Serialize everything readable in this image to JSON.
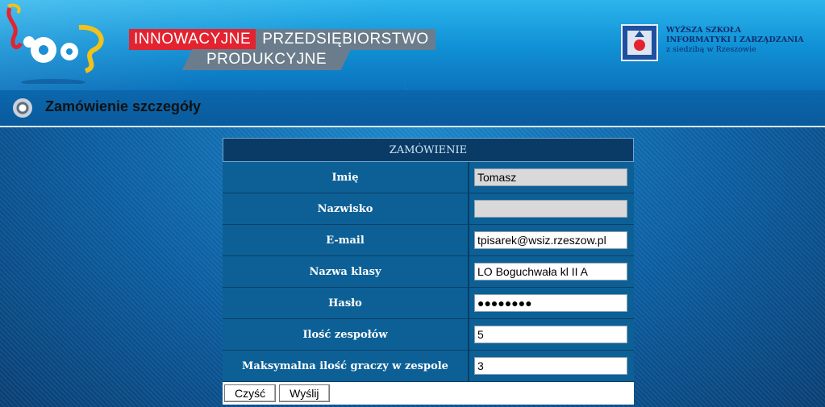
{
  "header": {
    "brand_line1_red": "INNOWACYJNE",
    "brand_line1_gray": "PRZEDSIĘBIORSTWO",
    "brand_line2_gray": "PRODUKCYJNE",
    "school_line1": "WYŻSZA SZKOŁA",
    "school_line2": "INFORMATYKI I ZARZĄDZANIA",
    "school_line3": "z siedzibą w Rzeszowie"
  },
  "page": {
    "title": "Zamówienie szczegóły"
  },
  "form": {
    "title": "ZAMÓWIENIE",
    "fields": [
      {
        "label": "Imię",
        "value": "Tomasz",
        "disabled": true
      },
      {
        "label": "Nazwisko",
        "value": "",
        "disabled": true
      },
      {
        "label": "E-mail",
        "value": "tpisarek@wsiz.rzeszow.pl",
        "disabled": false
      },
      {
        "label": "Nazwa klasy",
        "value": "LO Boguchwała kl II A",
        "disabled": false
      },
      {
        "label": "Hasło",
        "value": "●●●●●●●●",
        "disabled": false
      },
      {
        "label": "Ilość zespołów",
        "value": "5",
        "disabled": false
      },
      {
        "label": "Maksymalna ilość graczy w zespole",
        "value": "3",
        "disabled": false
      }
    ],
    "buttons": {
      "clear": "Czyść",
      "send": "Wyślij"
    }
  },
  "colors": {
    "accent_red": "#e3232f",
    "brand_gray": "#6b7d8c",
    "form_header": "#0a3b66"
  }
}
